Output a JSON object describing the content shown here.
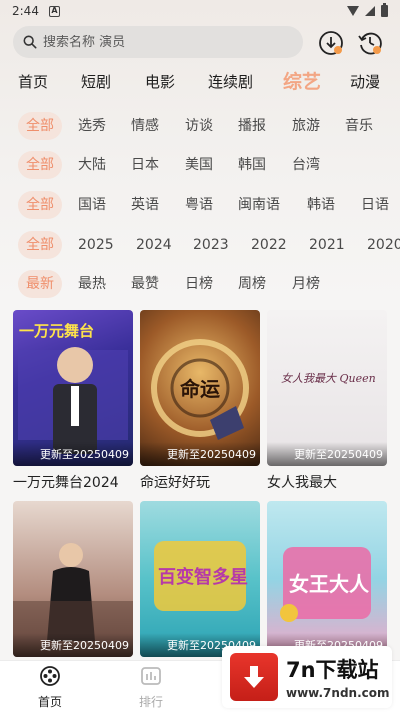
{
  "status": {
    "time": "2:44",
    "sys_icon": "A"
  },
  "search": {
    "placeholder": "搜索名称 演员",
    "value": ""
  },
  "main_tabs": [
    {
      "label": "首页"
    },
    {
      "label": "短剧"
    },
    {
      "label": "电影"
    },
    {
      "label": "连续剧"
    },
    {
      "label": "综艺",
      "active": true
    },
    {
      "label": "动漫"
    }
  ],
  "filters": {
    "type": [
      "全部",
      "选秀",
      "情感",
      "访谈",
      "播报",
      "旅游",
      "音乐"
    ],
    "region": [
      "全部",
      "大陆",
      "日本",
      "美国",
      "韩国",
      "台湾"
    ],
    "language": [
      "全部",
      "国语",
      "英语",
      "粤语",
      "闽南语",
      "韩语",
      "日语"
    ],
    "year": [
      "全部",
      "2025",
      "2024",
      "2023",
      "2022",
      "2021",
      "2020"
    ],
    "sort": [
      "最新",
      "最热",
      "最赞",
      "日榜",
      "周榜",
      "月榜"
    ]
  },
  "cards": [
    {
      "title": "一万元舞台2024",
      "update": "更新至20250409",
      "poster_text": "一万元舞台"
    },
    {
      "title": "命运好好玩",
      "update": "更新至20250409",
      "poster_text": "命运"
    },
    {
      "title": "女人我最大",
      "update": "更新至20250409",
      "poster_text": "女人我最大 Queen"
    },
    {
      "title": "",
      "update": "更新至20250409",
      "poster_text": ""
    },
    {
      "title": "",
      "update": "更新至20250409",
      "poster_text": "百变智多星"
    },
    {
      "title": "",
      "update": "更新至20250409",
      "poster_text": "女王大人"
    }
  ],
  "bottom_nav": [
    {
      "label": "首页",
      "icon": "film-reel-icon",
      "active": true
    },
    {
      "label": "排行",
      "icon": "ranking-icon",
      "active": false
    }
  ],
  "watermark": {
    "title": "7n下载站",
    "url": "www.7ndn.com"
  },
  "colors": {
    "accent": "#ef8f6c",
    "chip_bg": "#f5e4dc",
    "tab_active": "#f3a684"
  }
}
